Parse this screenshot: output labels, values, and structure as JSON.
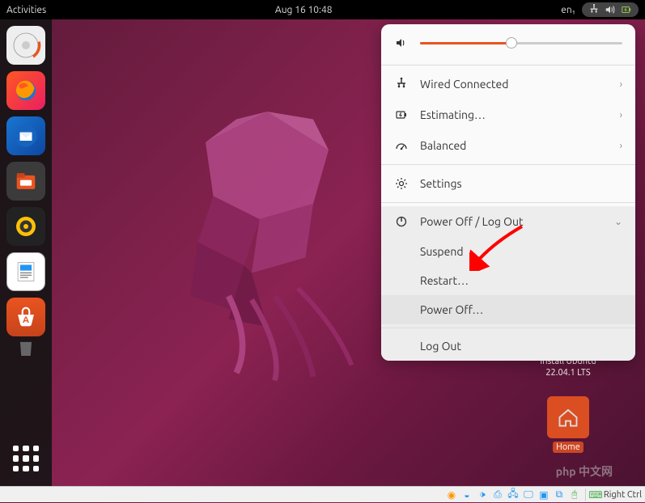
{
  "topbar": {
    "activities": "Activities",
    "datetime": "Aug 16  10:48",
    "input": "en₁"
  },
  "sysmenu": {
    "volume_percent": 45,
    "wired": "Wired Connected",
    "battery": "Estimating…",
    "power_profile": "Balanced",
    "settings": "Settings",
    "power_section": "Power Off / Log Out",
    "suspend": "Suspend",
    "restart": "Restart…",
    "poweroff": "Power Off…",
    "logout": "Log Out"
  },
  "desktop": {
    "install_label": "Install Ubuntu 22.04.1 LTS",
    "home_label": "Home"
  },
  "watermark": "php 中文网",
  "vb": {
    "hostkey": "Right Ctrl"
  }
}
